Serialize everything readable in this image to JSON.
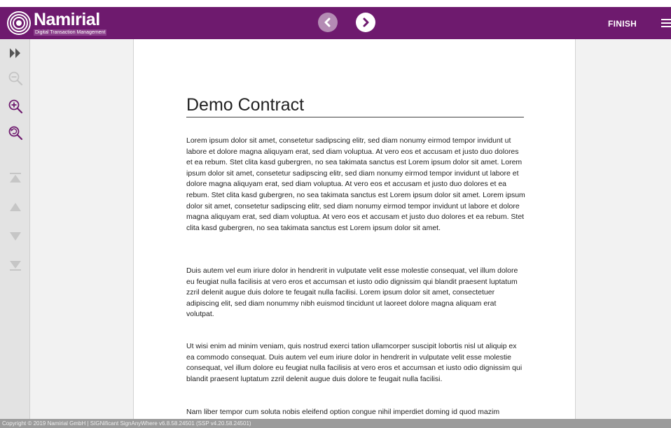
{
  "brand": {
    "name": "Namirial",
    "tagline": "Digital Transaction Management"
  },
  "header": {
    "finish_label": "FINISH"
  },
  "document": {
    "title": "Demo Contract",
    "paragraphs": [
      "Lorem ipsum dolor sit amet, consetetur sadipscing elitr, sed diam nonumy eirmod tempor invidunt ut labore et dolore magna aliquyam erat, sed diam voluptua. At vero eos et accusam et justo duo dolores et ea rebum. Stet clita kasd gubergren, no sea takimata sanctus est Lorem ipsum dolor sit amet. Lorem ipsum dolor sit amet, consetetur sadipscing elitr, sed diam nonumy eirmod tempor invidunt ut labore et dolore magna aliquyam erat, sed diam voluptua. At vero eos et accusam et justo duo dolores et ea rebum. Stet clita kasd gubergren, no sea takimata sanctus est Lorem ipsum dolor sit amet. Lorem ipsum dolor sit amet, consetetur sadipscing elitr, sed diam nonumy eirmod tempor invidunt ut labore et dolore magna aliquyam erat, sed diam voluptua. At vero eos et accusam et justo duo dolores et ea rebum. Stet clita kasd gubergren, no sea takimata sanctus est Lorem ipsum dolor sit amet.",
      "Duis autem vel eum iriure dolor in hendrerit in vulputate velit esse molestie consequat, vel illum dolore eu feugiat nulla facilisis at vero eros et accumsan et iusto odio dignissim qui blandit praesent luptatum zzril delenit augue duis dolore te feugait nulla facilisi. Lorem ipsum dolor sit amet, consectetuer adipiscing elit, sed diam nonummy nibh euismod tincidunt ut laoreet dolore magna aliquam erat volutpat.",
      "Ut wisi enim ad minim veniam, quis nostrud exerci tation ullamcorper suscipit lobortis nisl ut aliquip ex ea commodo consequat. Duis autem vel eum iriure dolor in hendrerit in vulputate velit esse molestie consequat, vel illum dolore eu feugiat nulla facilisis at vero eros et accumsan et iusto odio dignissim qui blandit praesent luptatum zzril delenit augue duis dolore te feugait nulla facilisi.",
      "Nam liber tempor cum soluta nobis eleifend option congue nihil imperdiet doming id quod mazim"
    ]
  },
  "footer": {
    "copyright": "Copyright © 2019 Namirial GmbH | SIGNificant SignAnyWhere v6.8.58.24501 (SSP v4.20.58.24501)"
  },
  "icons": {
    "logo": "namirial-logo-icon",
    "prev": "chevron-left-icon",
    "next": "chevron-right-icon",
    "menu": "hamburger-menu-icon",
    "expand": "double-chevron-right-icon",
    "zoom_out": "zoom-out-icon",
    "zoom_in": "zoom-in-icon",
    "zoom_reset": "zoom-reset-icon",
    "first": "first-page-icon",
    "up": "previous-page-icon",
    "down": "next-page-icon",
    "last": "last-page-icon"
  },
  "colors": {
    "brand": "#6e1a6e",
    "toolbar": "#e3e3e3",
    "viewer_bg": "#f2f2f2",
    "footer": "#9b9b9b"
  }
}
